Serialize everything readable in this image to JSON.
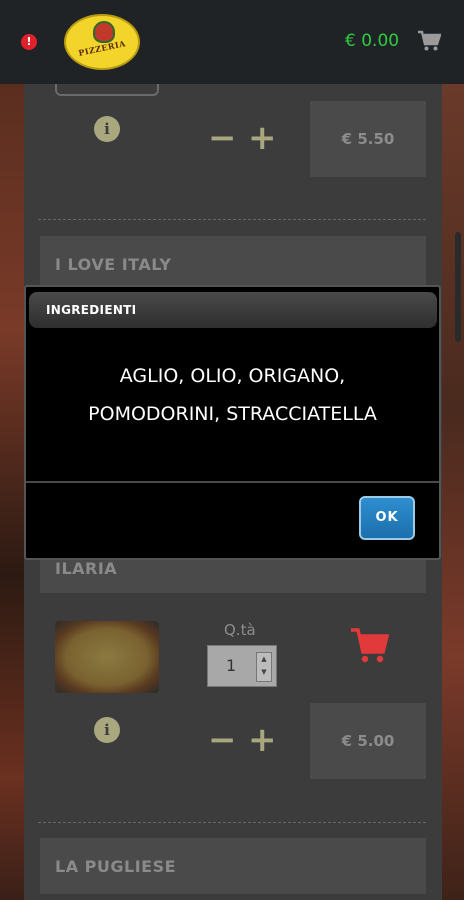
{
  "header": {
    "alert_badge": "!",
    "logo_text": "PIZZERIA",
    "cart_total": "€ 0.00",
    "icons": {
      "alert": "alert-icon",
      "cart": "cart-icon"
    }
  },
  "products": [
    {
      "name": "",
      "price": "€ 5.50",
      "qty_label": "",
      "qty_value": ""
    },
    {
      "name": "I LOVE ITALY"
    },
    {
      "name": "ILARIA",
      "price": "€ 5.00",
      "qty_label": "Q.tà",
      "qty_value": "1"
    },
    {
      "name": "LA PUGLIESE"
    }
  ],
  "modal": {
    "title": "INGREDIENTI",
    "line1": "AGLIO, OLIO, ORIGANO,",
    "line2": "POMODORINI, STRACCIATELLA",
    "ok_label": "OK"
  },
  "colors": {
    "cart_total": "#2ecc40",
    "add_to_cart": "#e23a3a",
    "ok_button": "#1c6fab"
  }
}
